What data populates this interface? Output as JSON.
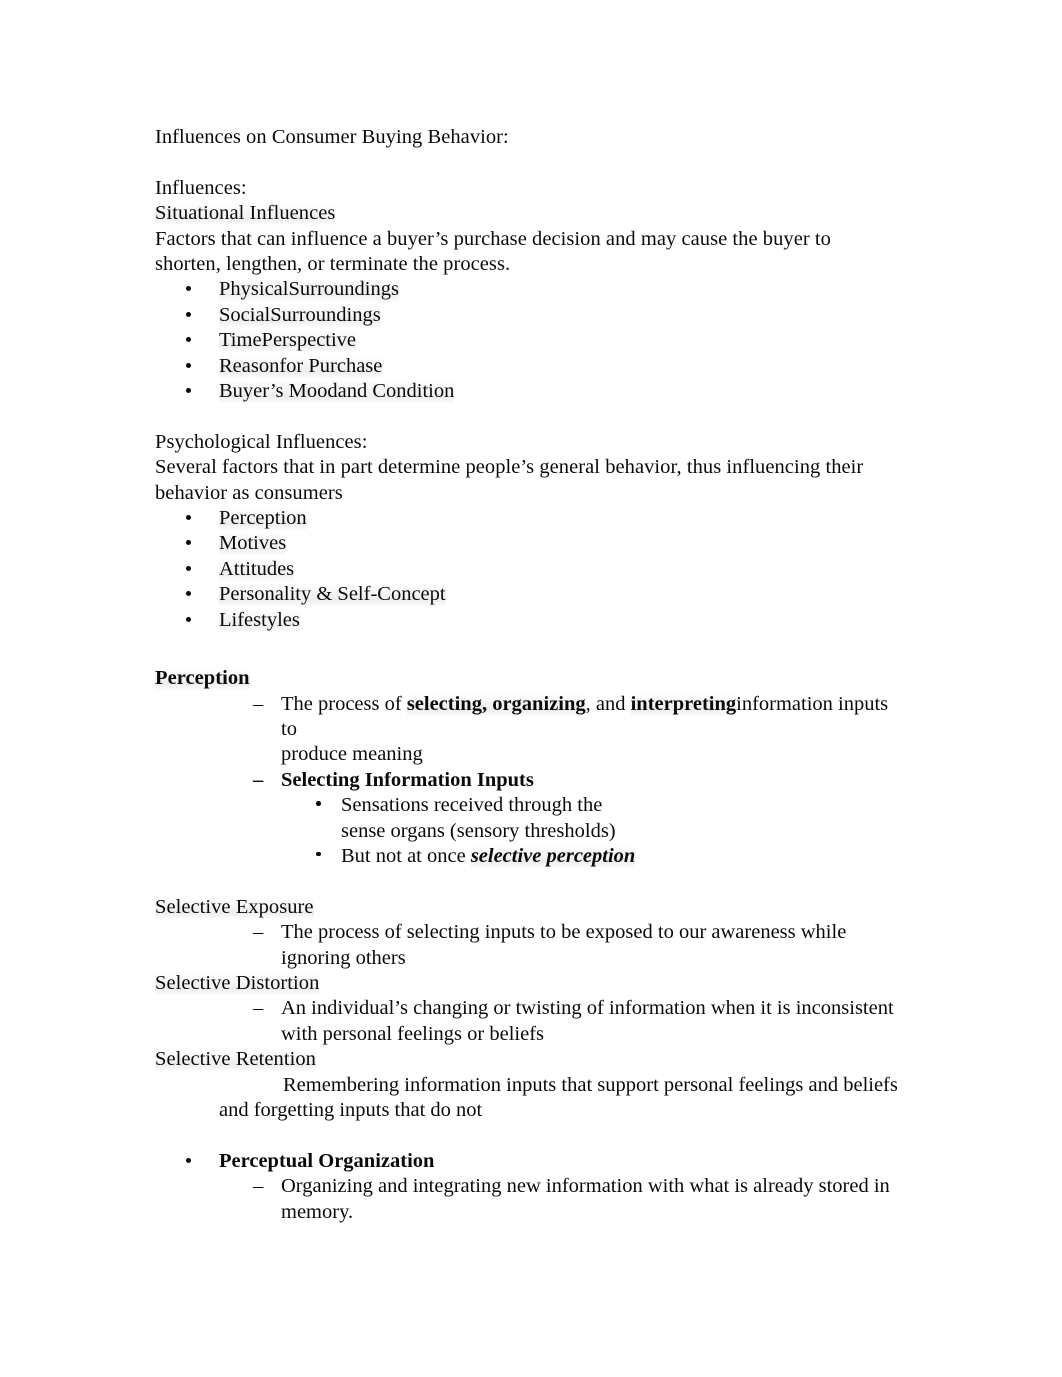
{
  "document": {
    "title_line": "Influences on Consumer Buying Behavior:",
    "sections": {
      "influences": {
        "heading": "Influences:",
        "subheading": "Situational Influences",
        "definition_line1": "Factors that can influence a buyer’s purchase decision and may cause the buyer to",
        "definition_line2": "shorten, lengthen, or terminate the process.",
        "items": [
          "PhysicalSurroundings",
          "SocialSurroundings",
          "TimePerspective",
          "Reasonfor Purchase",
          "Buyer’s Moodand Condition"
        ]
      },
      "psychological": {
        "heading": "Psychological Influences:",
        "definition_line1": "Several factors that in part determine people’s general behavior, thus influencing their",
        "definition_line2": "behavior as consumers",
        "items": [
          "Perception",
          "Motives",
          "Attitudes",
          "Personality & Self-Concept",
          "Lifestyles"
        ]
      },
      "perception": {
        "heading": "Perception",
        "def_part1": "The process of ",
        "def_bold1": "selecting, organizing",
        "def_part2": ", and ",
        "def_bold2": "interpreting",
        "def_part3": "information inputs",
        "def_line2": "to",
        "def_line3": "produce meaning",
        "selecting_heading": "Selecting Information Inputs",
        "sensations_line1": "Sensations received through the",
        "sensations_line2": "sense organs (sensory thresholds)",
        "not_at_once_text": "But not at once  ",
        "not_at_once_emphasis": "selective perception"
      },
      "selective_exposure": {
        "heading": "Selective Exposure",
        "def_line1": "The process of selecting inputs to be exposed to our awareness while",
        "def_line2": "ignoring others"
      },
      "selective_distortion": {
        "heading": "Selective Distortion",
        "def_line1": "An individual’s changing or twisting of information when it is inconsistent",
        "def_line2": "with personal feelings or beliefs"
      },
      "selective_retention": {
        "heading": "Selective Retention",
        "def_line1": "Remembering information inputs that support personal feelings and beliefs",
        "def_line2": "and forgetting inputs that do not"
      },
      "perceptual_organization": {
        "heading": "Perceptual Organization",
        "def_line1": "Organizing and integrating new information with what is already stored in",
        "def_line2": "memory."
      }
    },
    "glyphs": {
      "dash_bullet": "–"
    }
  }
}
